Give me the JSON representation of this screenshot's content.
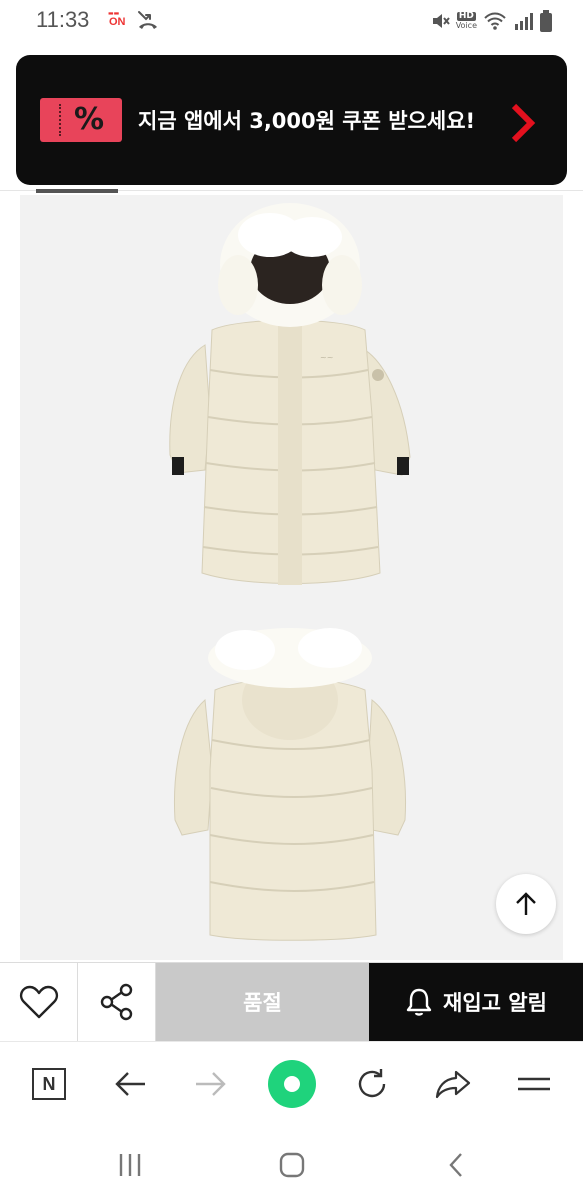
{
  "status_bar": {
    "time": "11:33",
    "on_badge": "ON",
    "hd_label": "HD",
    "voice_label": "Voice",
    "icons": [
      "on-app-icon",
      "missed-call-icon",
      "mute-icon",
      "wifi-icon",
      "signal-icon",
      "battery-icon"
    ]
  },
  "coupon_banner": {
    "icon_text": "%",
    "text": "지금 앱에서 3,000원 쿠폰 받으세요!",
    "accent_color": "#e8445a",
    "arrow_color": "#e3101e"
  },
  "product": {
    "images": [
      "coat-front-image",
      "coat-back-image"
    ]
  },
  "action_bar": {
    "soldout_label": "품절",
    "restock_label": "재입고 알림"
  },
  "browser_toolbar": {
    "icons": [
      "naver-n-icon",
      "back-arrow-icon",
      "forward-arrow-icon",
      "green-dot-icon",
      "refresh-icon",
      "share-forward-icon",
      "menu-icon"
    ],
    "n_label": "N"
  },
  "system_nav": {
    "icons": [
      "recent-apps-icon",
      "home-icon",
      "back-icon"
    ]
  }
}
